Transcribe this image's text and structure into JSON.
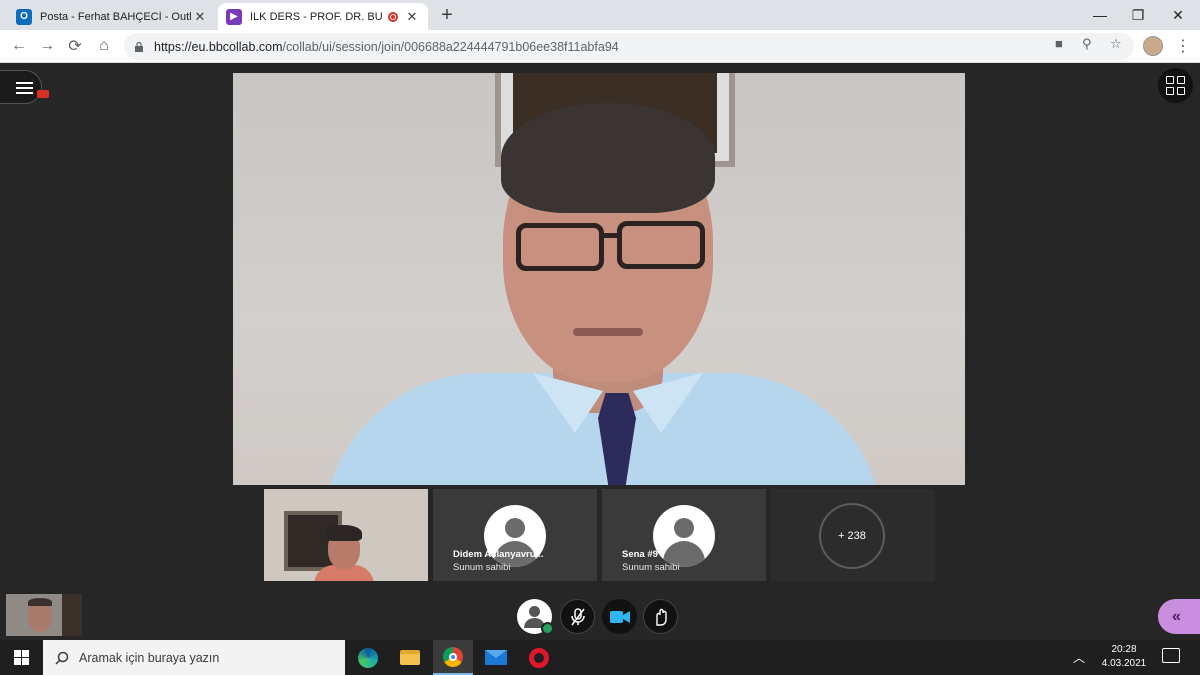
{
  "browser": {
    "tabs": [
      {
        "title": "Posta - Ferhat BAHÇECİ - Outlook",
        "icon": "outlook-icon",
        "close": "✕"
      },
      {
        "title": "İLK DERS - PROF. DR. BURHAN",
        "icon": "blackboard-collaborate-icon",
        "close": "✕"
      }
    ],
    "new_tab": "+",
    "window_controls": {
      "minimize": "—",
      "restore": "❐",
      "close": "✕"
    },
    "url_host": "https://eu.bbcollab.com",
    "url_path": "/collab/ui/session/join/006688a224444791b06ee38f11abfa94"
  },
  "session": {
    "participants": [
      {
        "name": "",
        "role": ""
      },
      {
        "name": "Didem Aslanyavru...",
        "role": "Sunum sahibi"
      },
      {
        "name": "Sena #9",
        "role": "Sunum sahibi"
      }
    ],
    "more_count": "+ 238"
  },
  "taskbar": {
    "search_placeholder": "Aramak için buraya yazın",
    "time": "20:28",
    "date": "4.03.2021"
  },
  "colors": {
    "stage_bg": "#262626",
    "accent_purple": "#c98ee0",
    "recording_red": "#d93025",
    "status_green": "#23a35a"
  }
}
